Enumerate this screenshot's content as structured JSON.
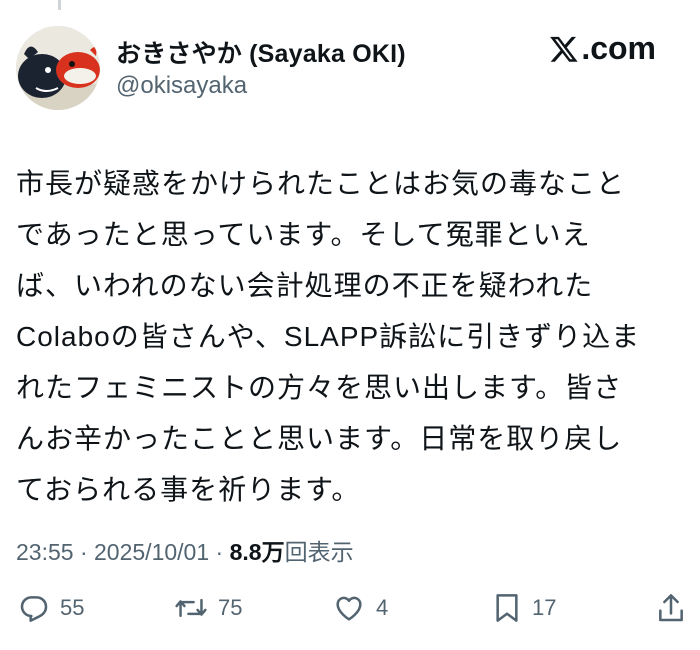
{
  "author": {
    "display_name": "おきさやか (Sayaka OKI)",
    "handle": "@okisayaka",
    "avatar_icon": "two-whale-plush-avatar"
  },
  "site": {
    "label": ".com",
    "logo_icon": "x-logo-icon"
  },
  "tweet": {
    "lines": [
      "市長が疑惑をかけられたことはお気の毒なこと",
      "であったと思っています。そして冤罪といえ",
      "ば、いわれのない会計処理の不正を疑われた",
      "Colaboの皆さんや、SLAPP訴訟に引きずり込ま",
      "れたフェミニストの方々を思い出します。皆さ",
      "んお辛かったことと思います。日常を取り戻し",
      "ておられる事を祈ります。"
    ]
  },
  "meta": {
    "time": "23:55",
    "sep1": " · ",
    "date": "2025/10/01",
    "sep2": " · ",
    "views": "8.8万",
    "views_label": "回表示"
  },
  "actions": {
    "reply": {
      "icon": "reply-icon",
      "count": "55"
    },
    "repost": {
      "icon": "repost-icon",
      "count": "75"
    },
    "like": {
      "icon": "heart-icon",
      "count": "4"
    },
    "bookmark": {
      "icon": "bookmark-icon",
      "count": "17"
    },
    "share": {
      "icon": "share-icon"
    }
  }
}
